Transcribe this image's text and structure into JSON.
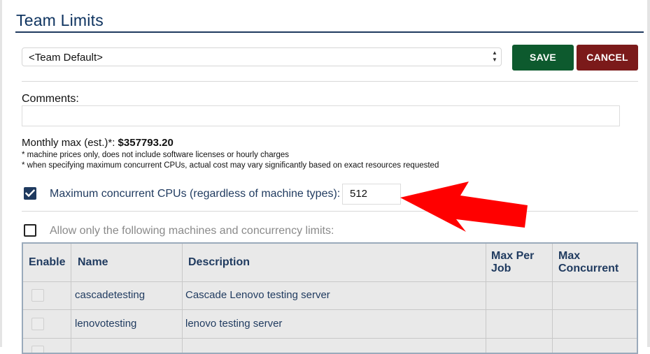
{
  "header": {
    "title": "Team Limits"
  },
  "team_select": {
    "value": "<Team Default>"
  },
  "actions": {
    "save_label": "SAVE",
    "cancel_label": "CANCEL"
  },
  "comments": {
    "label": "Comments:",
    "value": ""
  },
  "monthly": {
    "label": "Monthly max (est.)*: ",
    "value": "$357793.20",
    "note1": "* machine prices only, does not include software licenses or hourly charges",
    "note2": "* when specifying maximum concurrent CPUs, actual cost may vary significantly based on exact resources requested"
  },
  "cpu_limit": {
    "checked": true,
    "label": "Maximum concurrent CPUs (regardless of machine types):",
    "value": "512"
  },
  "machine_limits": {
    "checked": false,
    "label": "Allow only the following machines and concurrency limits:"
  },
  "table": {
    "headers": {
      "enable": "Enable",
      "name": "Name",
      "description": "Description",
      "max_per_job": "Max Per Job",
      "max_concurrent": "Max Concurrent"
    },
    "rows": [
      {
        "enabled": false,
        "name": "cascadetesting",
        "description": "Cascade Lenovo testing server",
        "max_per_job": "",
        "max_concurrent": ""
      },
      {
        "enabled": false,
        "name": "lenovotesting",
        "description": "lenovo testing server",
        "max_per_job": "",
        "max_concurrent": ""
      }
    ]
  },
  "colors": {
    "primary": "#1f3a5f",
    "save": "#0d5a2e",
    "cancel": "#7b1a1a",
    "annotation_arrow": "#ff0000"
  }
}
